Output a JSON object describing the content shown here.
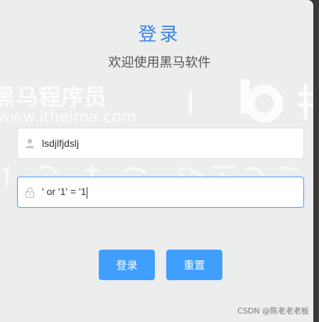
{
  "login": {
    "title": "登录",
    "subtitle": "欢迎使用黑马软件",
    "username_value": "lsdjlfjdslj",
    "password_value": "' or '1' = '1",
    "login_button": "登录",
    "reset_button": "重置"
  },
  "watermark": {
    "brand_text": "黑马程序员",
    "url_text": "www.itheima.com"
  },
  "footer": {
    "credit": "CSDN @陈老老老板"
  },
  "colors": {
    "accent": "#409eff",
    "title": "#3b82e6",
    "panel_bg": "#eceded"
  }
}
